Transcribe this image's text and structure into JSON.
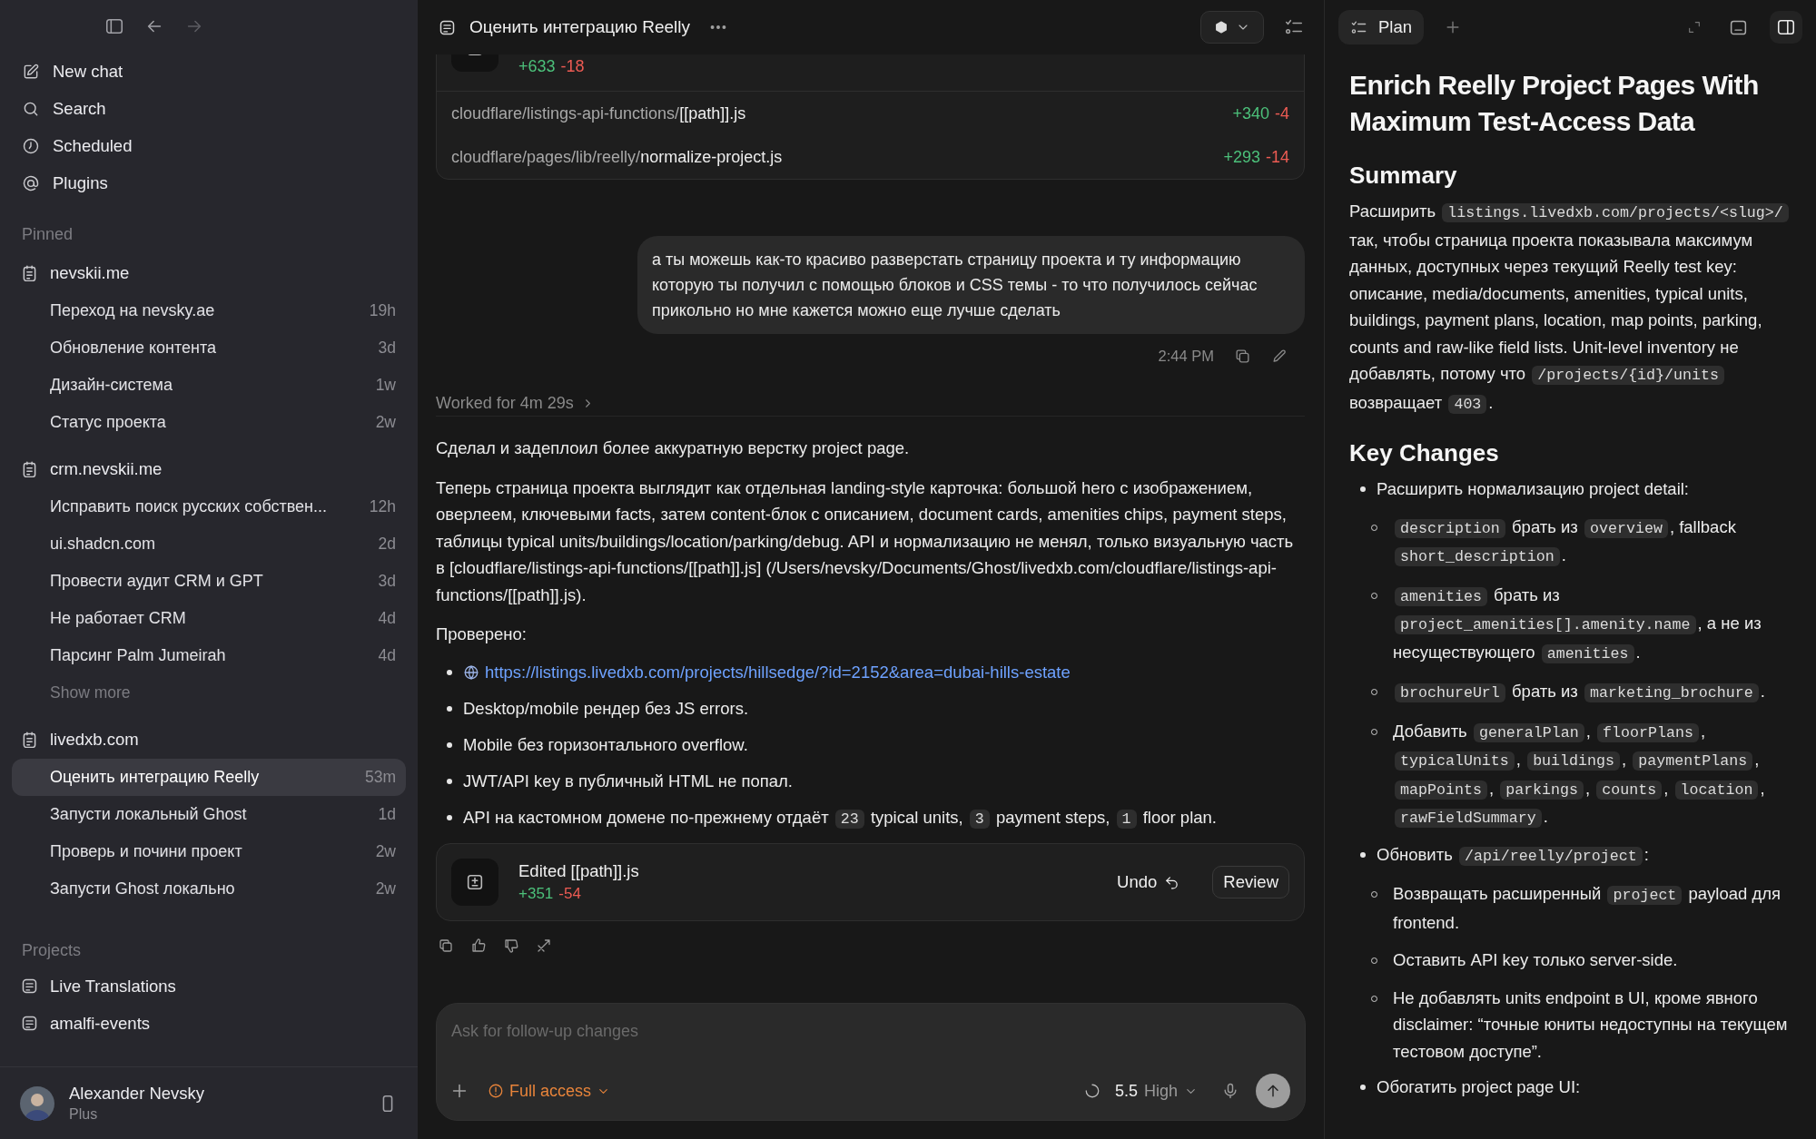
{
  "sidebar": {
    "nav": [
      {
        "kind": "new_chat",
        "label": "New chat"
      },
      {
        "kind": "search",
        "label": "Search"
      },
      {
        "kind": "scheduled",
        "label": "Scheduled"
      },
      {
        "kind": "plugins",
        "label": "Plugins"
      }
    ],
    "pinned": {
      "heading": "Pinned",
      "folders": [
        {
          "name": "nevskii.me",
          "threads": [
            {
              "title": "Переход на nevsky.ae",
              "age": "19h",
              "selected": false
            },
            {
              "title": "Обновление контента",
              "age": "3d",
              "selected": false
            },
            {
              "title": "Дизайн-система",
              "age": "1w",
              "selected": false
            },
            {
              "title": "Статус проекта",
              "age": "2w",
              "selected": false
            }
          ]
        },
        {
          "name": "crm.nevskii.me",
          "threads": [
            {
              "title": "Исправить поиск русских собствен...",
              "age": "12h",
              "selected": false
            },
            {
              "title": "ui.shadcn.com",
              "age": "2d",
              "selected": false
            },
            {
              "title": "Провести аудит CRM и GPT",
              "age": "3d",
              "selected": false
            },
            {
              "title": "Не работает CRM",
              "age": "4d",
              "selected": false
            },
            {
              "title": "Парсинг Palm Jumeirah",
              "age": "4d",
              "selected": false
            }
          ],
          "more": "Show more"
        },
        {
          "name": "livedxb.com",
          "threads": [
            {
              "title": "Оценить интеграцию Reelly",
              "age": "53m",
              "selected": true
            },
            {
              "title": "Запусти локальный Ghost",
              "age": "1d",
              "selected": false
            },
            {
              "title": "Проверь и почини проект",
              "age": "2w",
              "selected": false
            },
            {
              "title": "Запусти Ghost локально",
              "age": "2w",
              "selected": false
            }
          ]
        }
      ]
    },
    "projects": {
      "heading": "Projects",
      "items": [
        {
          "name": "Live Translations"
        },
        {
          "name": "amalfi-events"
        }
      ]
    },
    "user": {
      "name": "Alexander Nevsky",
      "plan": "Plus"
    }
  },
  "thread": {
    "title": "Оценить интеграцию Reelly"
  },
  "diff_card": {
    "added": "+633",
    "removed": "-18",
    "files": [
      {
        "dir": "cloudflare/listings-api-functions/",
        "file": "[[path]].js",
        "added": "+340",
        "removed": "-4"
      },
      {
        "dir": "cloudflare/pages/lib/reelly/",
        "file": "normalize-project.js",
        "added": "+293",
        "removed": "-14"
      }
    ]
  },
  "user_message": {
    "text": "а ты можешь как-то красиво разверстать страницу проекта и ту информацию которую ты получил с помощью блоков и CSS темы - то что получилось сейчас прикольно но мне кажется можно еще лучше сделать",
    "time": "2:44 PM"
  },
  "worked": "Worked for 4m 29s",
  "reply": {
    "paragraphs": [
      "Сделал и задеплоил более аккуратную верстку project page.",
      "Теперь страница проекта выглядит как отдельная landing-style карточка: большой hero с изображением, оверлеем, ключевыми facts, затем content-блок с описанием, document cards, amenities chips, payment steps, таблицы typical units/buildings/location/parking/debug. API и нормализацию не менял, только визуальную часть в [cloudflare/listings-api-functions/[[path]].js] (/Users/nevsky/Documents/Ghost/livedxb.com/cloudflare/listings-api-functions/[[path]].js)."
    ],
    "checked": "Проверено:",
    "bullets": [
      {
        "kind": "link",
        "text": "https://listings.livedxb.com/projects/hillsedge/?id=2152&area=dubai-hills-estate"
      },
      {
        "kind": "text",
        "segments": [
          {
            "kind": "text",
            "text": "Desktop/mobile рендер без JS errors."
          }
        ]
      },
      {
        "kind": "text",
        "segments": [
          {
            "kind": "text",
            "text": "Mobile без горизонтального overflow."
          }
        ]
      },
      {
        "kind": "text",
        "segments": [
          {
            "kind": "text",
            "text": "JWT/API key в публичный HTML не попал."
          }
        ]
      },
      {
        "kind": "text",
        "segments": [
          {
            "kind": "text",
            "text": "API на кастомном домене по-прежнему отдаёт "
          },
          {
            "kind": "code",
            "text": "23"
          },
          {
            "kind": "text",
            "text": " typical units, "
          },
          {
            "kind": "code",
            "text": "3"
          },
          {
            "kind": "text",
            "text": " payment steps, "
          },
          {
            "kind": "code",
            "text": "1"
          },
          {
            "kind": "text",
            "text": " floor plan."
          }
        ]
      }
    ]
  },
  "edit_card": {
    "title": "Edited [[path]].js",
    "added": "+351",
    "removed": "-54",
    "undo": "Undo",
    "review": "Review"
  },
  "composer": {
    "placeholder": "Ask for follow-up changes",
    "access": "Full access",
    "model": "5.5",
    "effort": "High"
  },
  "plan": {
    "tab": "Plan",
    "title": "Enrich Reelly Project Pages With Maximum Test-Access Data",
    "sections": [
      {
        "heading": "Summary",
        "kind": "paragraph",
        "segments": [
          {
            "kind": "text",
            "text": "Расширить "
          },
          {
            "kind": "code",
            "text": "listings.livedxb.com/projects/<slug>/"
          },
          {
            "kind": "text",
            "text": " так, чтобы страница проекта показывала максимум данных, доступных через текущий Reelly test key: описание, media/documents, amenities, typical units, buildings, payment plans, location, map points, parking, counts and raw-like field lists. Unit-level inventory не добавлять, потому что "
          },
          {
            "kind": "code",
            "text": "/projects/{id}/units"
          },
          {
            "kind": "text",
            "text": " возвращает "
          },
          {
            "kind": "code",
            "text": "403"
          },
          {
            "kind": "text",
            "text": "."
          }
        ]
      },
      {
        "heading": "Key Changes",
        "kind": "list",
        "items": [
          {
            "segments": [
              {
                "kind": "text",
                "text": "Расширить нормализацию project detail:"
              }
            ],
            "children": [
              {
                "segments": [
                  {
                    "kind": "code",
                    "text": "description"
                  },
                  {
                    "kind": "text",
                    "text": " брать из "
                  },
                  {
                    "kind": "code",
                    "text": "overview"
                  },
                  {
                    "kind": "text",
                    "text": ", fallback "
                  },
                  {
                    "kind": "code",
                    "text": "short_description"
                  },
                  {
                    "kind": "text",
                    "text": "."
                  }
                ]
              },
              {
                "segments": [
                  {
                    "kind": "code",
                    "text": "amenities"
                  },
                  {
                    "kind": "text",
                    "text": " брать из "
                  },
                  {
                    "kind": "code",
                    "text": "project_amenities[].amenity.name"
                  },
                  {
                    "kind": "text",
                    "text": ", а не из несуществующего "
                  },
                  {
                    "kind": "code",
                    "text": "amenities"
                  },
                  {
                    "kind": "text",
                    "text": "."
                  }
                ]
              },
              {
                "segments": [
                  {
                    "kind": "code",
                    "text": "brochureUrl"
                  },
                  {
                    "kind": "text",
                    "text": " брать из "
                  },
                  {
                    "kind": "code",
                    "text": "marketing_brochure"
                  },
                  {
                    "kind": "text",
                    "text": "."
                  }
                ]
              },
              {
                "segments": [
                  {
                    "kind": "text",
                    "text": "Добавить "
                  },
                  {
                    "kind": "code",
                    "text": "generalPlan"
                  },
                  {
                    "kind": "text",
                    "text": ", "
                  },
                  {
                    "kind": "code",
                    "text": "floorPlans"
                  },
                  {
                    "kind": "text",
                    "text": ", "
                  },
                  {
                    "kind": "code",
                    "text": "typicalUnits"
                  },
                  {
                    "kind": "text",
                    "text": ", "
                  },
                  {
                    "kind": "code",
                    "text": "buildings"
                  },
                  {
                    "kind": "text",
                    "text": ", "
                  },
                  {
                    "kind": "code",
                    "text": "paymentPlans"
                  },
                  {
                    "kind": "text",
                    "text": ", "
                  },
                  {
                    "kind": "code",
                    "text": "mapPoints"
                  },
                  {
                    "kind": "text",
                    "text": ", "
                  },
                  {
                    "kind": "code",
                    "text": "parkings"
                  },
                  {
                    "kind": "text",
                    "text": ", "
                  },
                  {
                    "kind": "code",
                    "text": "counts"
                  },
                  {
                    "kind": "text",
                    "text": ", "
                  },
                  {
                    "kind": "code",
                    "text": "location"
                  },
                  {
                    "kind": "text",
                    "text": ", "
                  },
                  {
                    "kind": "code",
                    "text": "rawFieldSummary"
                  },
                  {
                    "kind": "text",
                    "text": "."
                  }
                ]
              }
            ]
          },
          {
            "segments": [
              {
                "kind": "text",
                "text": "Обновить "
              },
              {
                "kind": "code",
                "text": "/api/reelly/project"
              },
              {
                "kind": "text",
                "text": ":"
              }
            ],
            "children": [
              {
                "segments": [
                  {
                    "kind": "text",
                    "text": "Возвращать расширенный "
                  },
                  {
                    "kind": "code",
                    "text": "project"
                  },
                  {
                    "kind": "text",
                    "text": " payload для frontend."
                  }
                ]
              },
              {
                "segments": [
                  {
                    "kind": "text",
                    "text": "Оставить API key только server-side."
                  }
                ]
              },
              {
                "segments": [
                  {
                    "kind": "text",
                    "text": "Не добавлять units endpoint в UI, кроме явного disclaimer: “точные юниты недоступны на текущем тестовом доступе”."
                  }
                ]
              }
            ]
          },
          {
            "segments": [
              {
                "kind": "text",
                "text": "Обогатить project page UI:"
              }
            ]
          }
        ]
      }
    ]
  }
}
